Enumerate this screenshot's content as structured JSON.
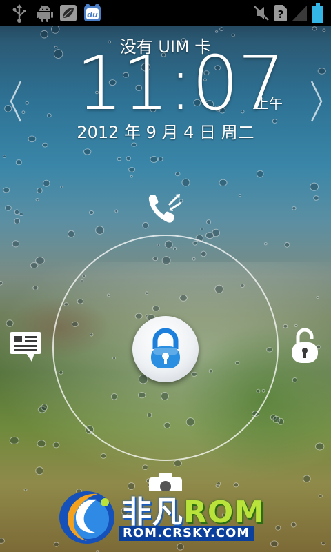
{
  "status_bar": {
    "left_icons": [
      "usb-icon",
      "android-debug-icon",
      "leaf-app-icon",
      "du-app-icon"
    ],
    "right_icons": [
      "vibrate-mute-icon",
      "no-sim-icon",
      "signal-icon",
      "battery-icon"
    ],
    "battery_color": "#33b5e5"
  },
  "lockscreen": {
    "carrier": "没有 UIM 卡",
    "time": "11:07",
    "ampm": "上午",
    "date": "2012 年 9 月 4 日 周二",
    "targets": {
      "top": "call-icon",
      "left": "message-icon",
      "right": "unlock-icon",
      "bottom": "camera-icon",
      "center": "lock-icon"
    },
    "accent_color": "#2a8fe0"
  },
  "watermark": {
    "title_cn": "非凡",
    "title_rom": "ROM",
    "url": "ROM.CRSKY.COM"
  }
}
